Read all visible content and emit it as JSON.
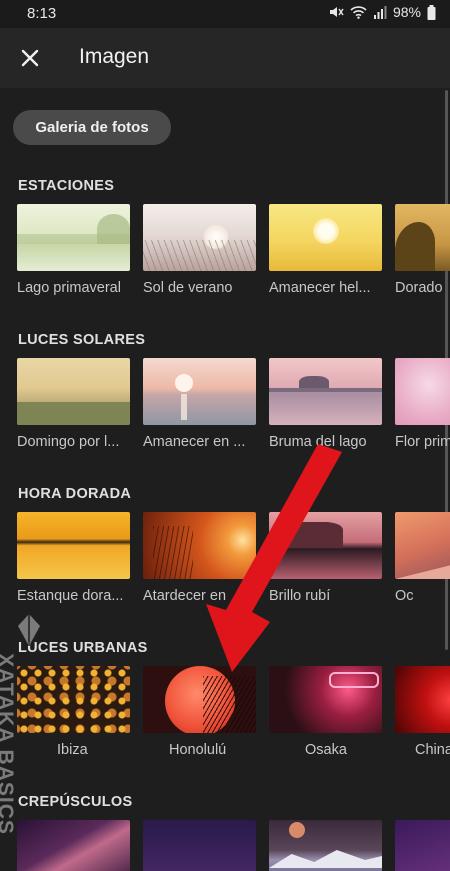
{
  "status": {
    "time": "8:13",
    "battery": "98%",
    "icons": [
      "mute-icon",
      "wifi-icon",
      "signal-icon",
      "battery-icon"
    ]
  },
  "header": {
    "title": "Imagen",
    "close_icon": "close-icon"
  },
  "gallery_button": "Galeria de fotos",
  "sections": [
    {
      "title": "ESTACIONES",
      "items": [
        "Lago primaveral",
        "Sol de verano",
        "Amanecer hel...",
        "Dorado"
      ]
    },
    {
      "title": "LUCES SOLARES",
      "items": [
        "Domingo por l...",
        "Amanecer en ...",
        "Bruma del lago",
        "Flor prim"
      ]
    },
    {
      "title": "HORA DORADA",
      "items": [
        "Estanque dora...",
        "Atardecer en",
        "Brillo rubí",
        "Oc"
      ]
    },
    {
      "title": "LUCES URBANAS",
      "items": [
        "Ibiza",
        "Honolulú",
        "Osaka",
        "China"
      ]
    },
    {
      "title": "CREPÚSCULOS",
      "items": [
        "",
        "",
        "",
        ""
      ]
    }
  ],
  "watermark": "XATAKA BASICS",
  "colors": {
    "background": "#1e1e1e",
    "appbar": "#262626",
    "button": "#4a4a4a",
    "arrow": "#e0151b"
  }
}
